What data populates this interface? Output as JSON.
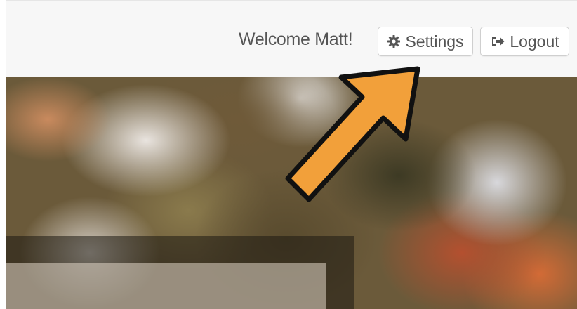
{
  "header": {
    "welcome_text": "Welcome Matt!",
    "settings_label": "Settings",
    "settings_icon": "gear-icon",
    "logout_label": "Logout",
    "logout_icon": "sign-out-icon"
  },
  "annotation": {
    "arrow_color": "#f2a03a",
    "arrow_target": "settings-button"
  },
  "colors": {
    "header_bg": "#f7f7f7",
    "button_border": "#cfcfcf",
    "text": "#555555"
  }
}
